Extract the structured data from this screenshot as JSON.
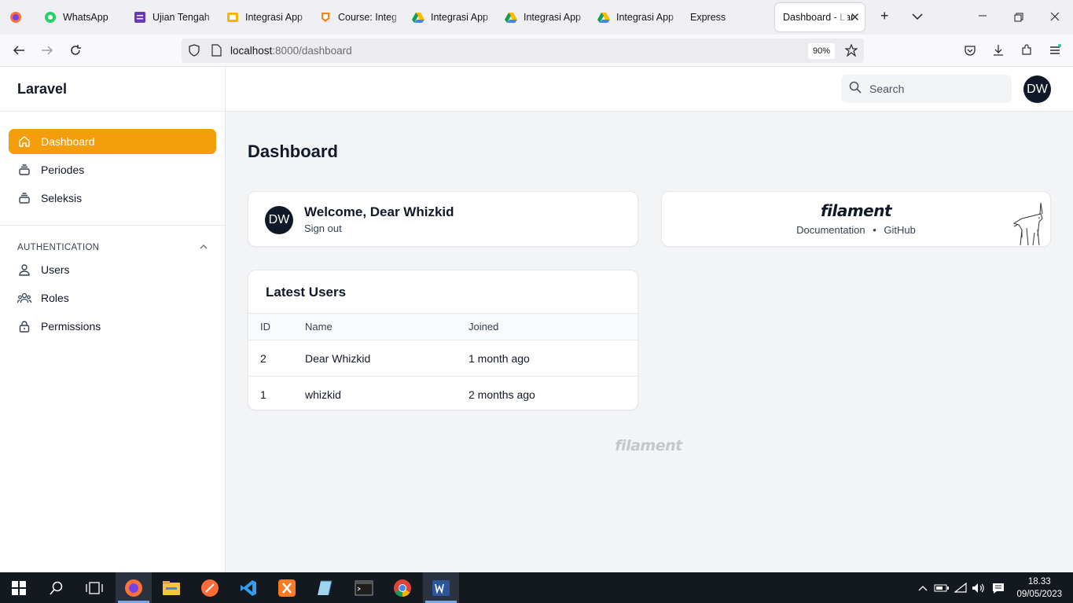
{
  "browser": {
    "tabs": [
      {
        "label": "",
        "icon": "firefox-icon"
      },
      {
        "label": "WhatsApp",
        "icon": "whatsapp-icon"
      },
      {
        "label": "Ujian Tengah S",
        "icon": "forms-icon"
      },
      {
        "label": "Integrasi App",
        "icon": "slides-icon"
      },
      {
        "label": "Course: Integr",
        "icon": "course-icon"
      },
      {
        "label": "Integrasi App I",
        "icon": "drive-icon"
      },
      {
        "label": "Integrasi App I",
        "icon": "drive-icon"
      },
      {
        "label": "Integrasi App I",
        "icon": "drive-icon"
      },
      {
        "label": "Express",
        "icon": "express-icon"
      },
      {
        "label": "Dashboard - Lar",
        "icon": "",
        "active": true
      }
    ],
    "url_host": "localhost",
    "url_rest": ":8000/dashboard",
    "zoom": "90%"
  },
  "app": {
    "brand": "Laravel",
    "nav": [
      {
        "label": "Dashboard",
        "icon": "home-icon",
        "active": true
      },
      {
        "label": "Periodes",
        "icon": "stack-icon"
      },
      {
        "label": "Seleksis",
        "icon": "stack-icon"
      }
    ],
    "group": {
      "label": "AUTHENTICATION",
      "items": [
        {
          "label": "Users",
          "icon": "user-icon"
        },
        {
          "label": "Roles",
          "icon": "users-group-icon"
        },
        {
          "label": "Permissions",
          "icon": "lock-icon"
        }
      ]
    },
    "search_placeholder": "Search",
    "avatar_initials": "DW",
    "page_title": "Dashboard",
    "welcome": {
      "initials": "DW",
      "title": "Welcome, Dear Whizkid",
      "signout": "Sign out"
    },
    "filament_card": {
      "logo": "filament",
      "doc_link": "Documentation",
      "separator": "•",
      "github_link": "GitHub"
    },
    "latest_users": {
      "title": "Latest Users",
      "columns": [
        "ID",
        "Name",
        "Joined"
      ],
      "rows": [
        {
          "id": "2",
          "name": "Dear Whizkid",
          "joined": "1 month ago"
        },
        {
          "id": "1",
          "name": "whizkid",
          "joined": "2 months ago"
        }
      ]
    },
    "footer_logo": "filament"
  },
  "taskbar": {
    "time": "18.33",
    "date": "09/05/2023",
    "colors": {
      "accent": "#f59e0b",
      "taskbar": "#14181f"
    }
  }
}
